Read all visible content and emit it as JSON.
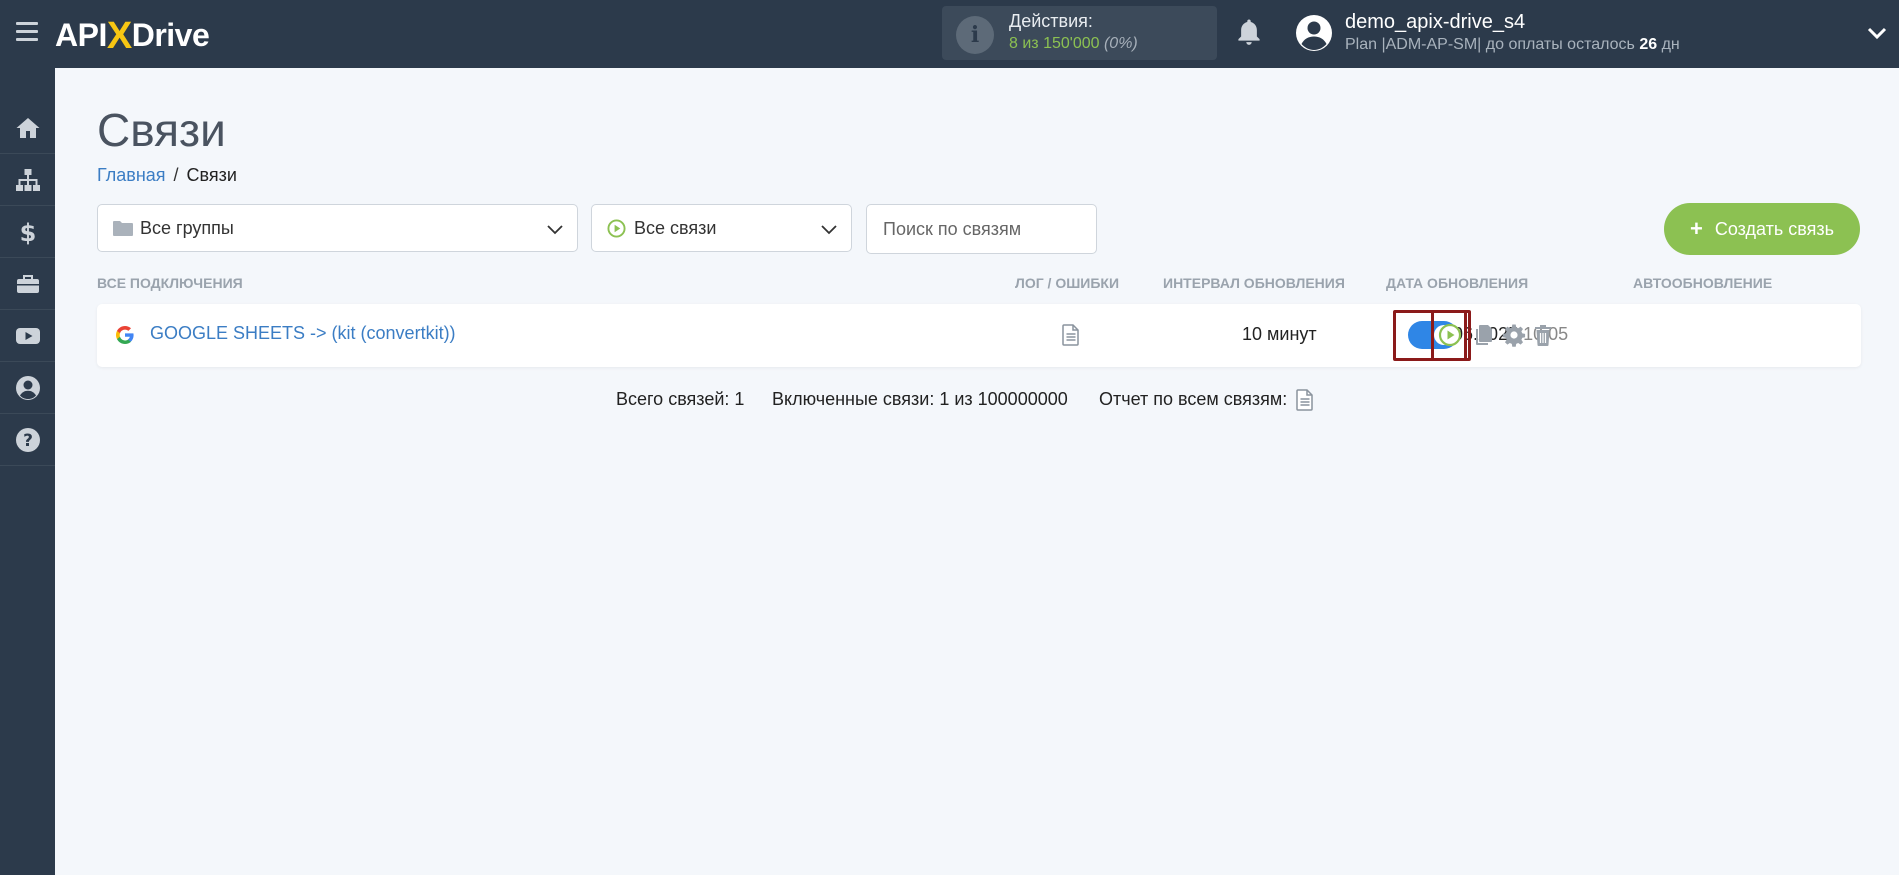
{
  "header": {
    "logo_api": "API",
    "logo_x": "X",
    "logo_drive": "Drive",
    "actions_label": "Действия:",
    "actions_value": "8 из 150'000",
    "actions_percent": "(0%)",
    "username": "demo_apix-drive_s4",
    "plan_text": "Plan |ADM-AP-SM| до оплаты осталось ",
    "plan_days": "26",
    "plan_days_unit": " дн"
  },
  "sidebar": {
    "items": [
      "home-icon",
      "sitemap-icon",
      "dollar-icon",
      "briefcase-icon",
      "youtube-icon",
      "user-icon",
      "help-icon"
    ]
  },
  "page": {
    "title": "Связи",
    "breadcrumb_home": "Главная",
    "breadcrumb_sep": "/",
    "breadcrumb_current": "Связи"
  },
  "filters": {
    "groups_value": "Все группы",
    "status_value": "Все связи",
    "search_placeholder": "Поиск по связям",
    "create_label": "Создать связь"
  },
  "table": {
    "headers": {
      "connections": "ВСЕ ПОДКЛЮЧЕНИЯ",
      "log": "ЛОГ / ОШИБКИ",
      "interval": "ИНТЕРВАЛ ОБНОВЛЕНИЯ",
      "date": "ДАТА ОБНОВЛЕНИЯ",
      "auto": "АВТООБНОВЛЕНИЕ"
    },
    "rows": [
      {
        "name": "GOOGLE SHEETS -> (kit (convertkit))",
        "interval": "10 минут",
        "date": "30.06.2025",
        "time": "10:05",
        "auto_enabled": true
      }
    ]
  },
  "footer": {
    "total": "Всего связей: 1",
    "enabled": "Включенные связи: 1 из 100000000",
    "report": "Отчет по всем связям:"
  },
  "colors": {
    "accent_green": "#8cc152",
    "link_blue": "#3b7dc4",
    "toggle_blue": "#2f86e6",
    "topbar": "#2c3a4b",
    "highlight": "#8b1a1a"
  }
}
